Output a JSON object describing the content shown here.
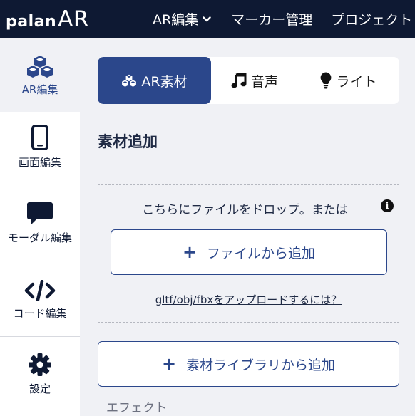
{
  "header": {
    "logo_a": "palan",
    "logo_b": "AR",
    "nav": [
      {
        "label": "AR編集"
      },
      {
        "label": "マーカー管理"
      },
      {
        "label": "プロジェクト"
      }
    ]
  },
  "sidebar": {
    "items": [
      {
        "label": "AR編集",
        "icon": "cubes-icon"
      },
      {
        "label": "画面編集",
        "icon": "mobile-icon"
      },
      {
        "label": "モーダル編集",
        "icon": "comment-icon"
      },
      {
        "label": "コード編集",
        "icon": "code-icon"
      },
      {
        "label": "設定",
        "icon": "gear-icon"
      }
    ]
  },
  "tabs": [
    {
      "label": "AR素材",
      "icon": "cubes-icon"
    },
    {
      "label": "音声",
      "icon": "music-icon"
    },
    {
      "label": "ライト",
      "icon": "lightbulb-icon"
    }
  ],
  "main": {
    "section_title": "素材追加",
    "drop_text": "こちらにファイルをドロップ。または",
    "info": "i",
    "file_button": "ファイルから追加",
    "plus": "+",
    "help_link": "gltf/obj/fbxをアップロードするには？",
    "library_button": "素材ライブラリから追加",
    "effect_label": "エフェクト"
  },
  "colors": {
    "header_bg": "#0e1933",
    "accent": "#2b478b",
    "page_bg": "#f0f1f5"
  }
}
